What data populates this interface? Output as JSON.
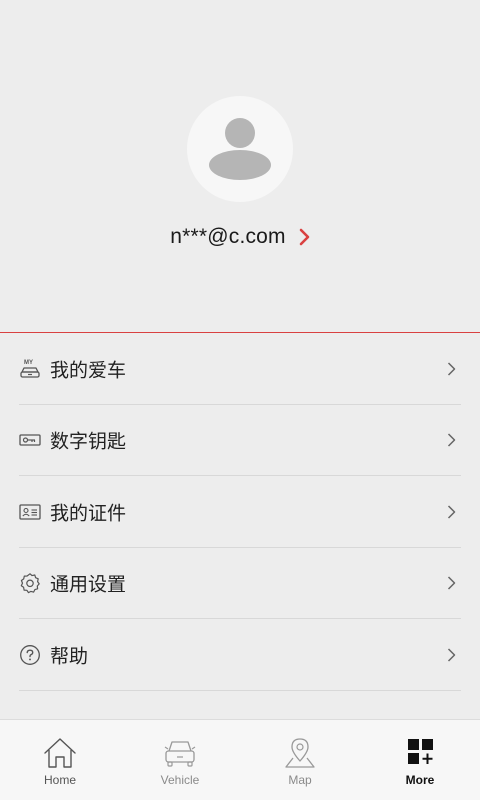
{
  "profile": {
    "email": "n***@c.com",
    "accent_color": "#d94141"
  },
  "menu": {
    "items": [
      {
        "label": "我的爱车",
        "icon": "my-car-icon"
      },
      {
        "label": "数字钥匙",
        "icon": "key-icon"
      },
      {
        "label": "我的证件",
        "icon": "id-card-icon"
      },
      {
        "label": "通用设置",
        "icon": "gear-icon"
      },
      {
        "label": "帮助",
        "icon": "help-icon"
      }
    ]
  },
  "tabbar": {
    "tabs": [
      {
        "label": "Home",
        "icon": "home-icon"
      },
      {
        "label": "Vehicle",
        "icon": "car-icon"
      },
      {
        "label": "Map",
        "icon": "map-pin-icon"
      },
      {
        "label": "More",
        "icon": "grid-plus-icon",
        "active": true
      }
    ]
  }
}
